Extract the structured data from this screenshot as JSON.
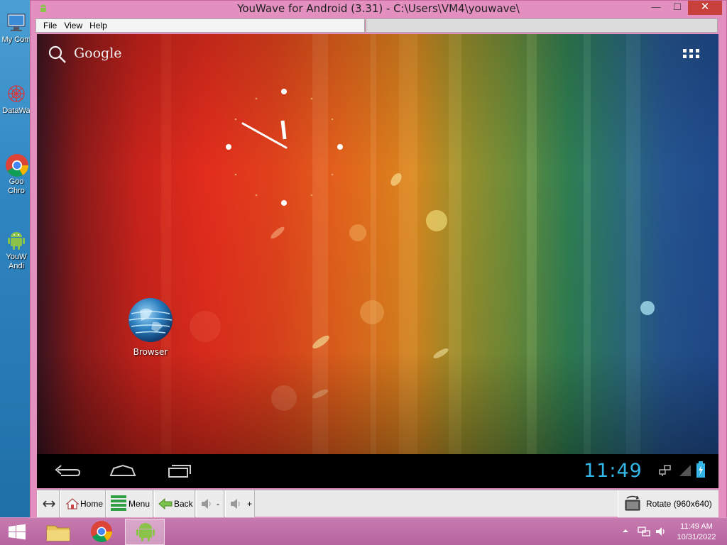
{
  "window": {
    "title": "YouWave for Android (3.31) - C:\\Users\\VM4\\youwave\\",
    "minimize_glyph": "—",
    "maximize_glyph": "☐",
    "close_glyph": "✕"
  },
  "menu": {
    "items": [
      {
        "label": "File"
      },
      {
        "label": "View"
      },
      {
        "label": "Help"
      }
    ]
  },
  "desktop": {
    "icons": [
      {
        "label": "My Com",
        "icon": "computer-icon"
      },
      {
        "label": "DataWa",
        "icon": "datawave-icon"
      },
      {
        "label": "Goo\nChro",
        "icon": "chrome-icon"
      },
      {
        "label": "YouW\nAndi",
        "icon": "android-icon"
      }
    ]
  },
  "android": {
    "search_label": "Google",
    "apps": [
      {
        "label": "Browser",
        "icon": "browser-globe-icon"
      }
    ],
    "status_time": "11:49"
  },
  "toolbar": {
    "home_label": "Home",
    "menu_label": "Menu",
    "back_label": "Back",
    "vol_down_label": "-",
    "vol_up_label": "+",
    "rotate_label": "Rotate (960x640)"
  },
  "taskbar": {
    "time": "11:49 AM",
    "date": "10/31/2022"
  },
  "colors": {
    "window_frame": "#e38fbf",
    "status_accent": "#33b5e5",
    "taskbar": "#c77bb0"
  }
}
